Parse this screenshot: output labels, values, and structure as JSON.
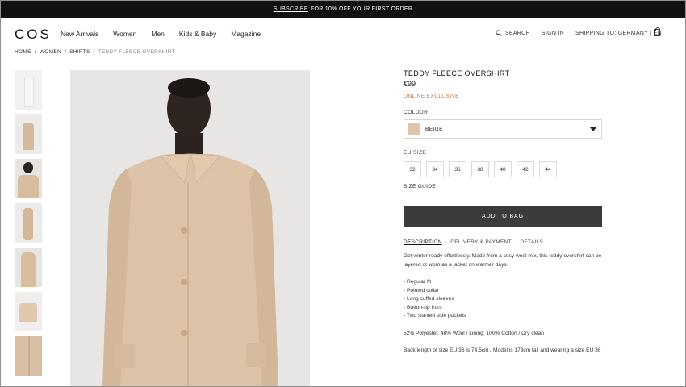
{
  "promo": {
    "link": "SUBSCRIBE",
    "text": "FOR 10% OFF YOUR FIRST ORDER"
  },
  "nav": {
    "logo": "COS",
    "menu": [
      "New Arrivals",
      "Women",
      "Men",
      "Kids & Baby",
      "Magazine"
    ],
    "search": "SEARCH",
    "sign_in": "SIGN IN",
    "shipping": "SHIPPING TO: GERMANY | EN",
    "bag_icon": "bag-icon"
  },
  "breadcrumb": [
    "HOME",
    "WOMEN",
    "SHIRTS",
    "TEDDY FLEECE OVERSHIRT"
  ],
  "product": {
    "name": "TEDDY FLEECE OVERSHIRT",
    "price": "€99",
    "badge": "ONLINE EXCLUSIVE",
    "colour_label": "COLOUR",
    "colour": "BEIGE",
    "swatch_color": "#dfc5ab",
    "size_label": "EU SIZE",
    "sizes": [
      "32",
      "34",
      "36",
      "38",
      "40",
      "42",
      "44"
    ],
    "size_guide": "SIZE GUIDE",
    "add_to_bag": "ADD TO BAG"
  },
  "tabs": [
    "DESCRIPTION",
    "DELIVERY & PAYMENT",
    "DETAILS"
  ],
  "description": "Get winter ready effortlessly. Made from a cosy wool mix, this teddy overshirt can be layered or worn as a jacket on warmer days.",
  "features": [
    "- Regular fit",
    "- Pointed collar",
    "- Long cuffed sleeves",
    "- Button-up front",
    "- Two slanted side pockets"
  ],
  "composition": "52% Polyester, 48% Wool /  Lining: 100% Cotton / Dry clean",
  "back_length": "Back length of size EU 36 is 74.5cm / Model is 178cm tall and wearing a size EU 36",
  "colors": {
    "promo_bg": "#111111",
    "exclusive": "#b87a39",
    "button_bg": "#3b3b3b"
  }
}
